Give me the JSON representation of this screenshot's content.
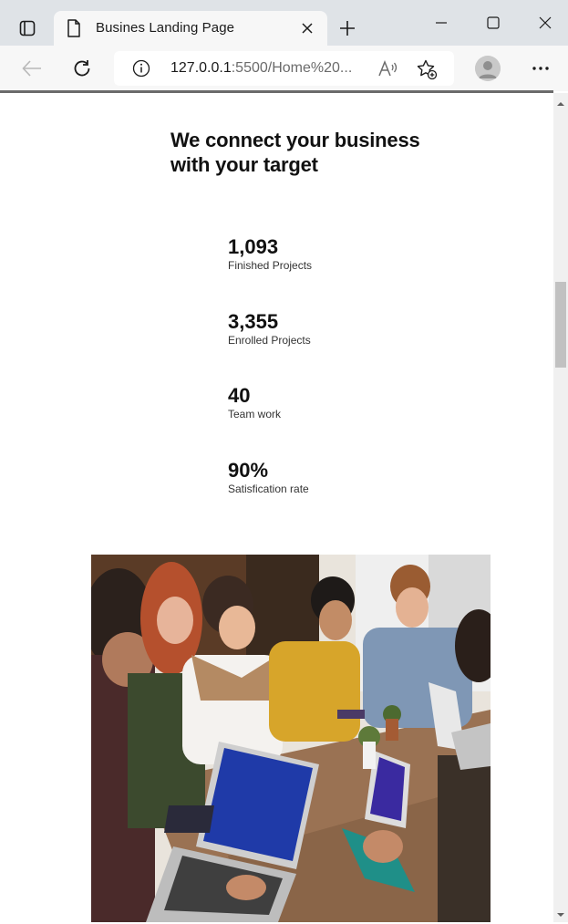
{
  "browser": {
    "tab_title": "Busines Landing Page",
    "url_host": "127.0.0.1",
    "url_path": ":5500/Home%20...",
    "read_aloud_label": "A",
    "icons": {
      "tabs": "tab-actions-icon",
      "page": "page-icon",
      "close": "close-icon",
      "new_tab": "plus-icon",
      "minimize": "minimize-icon",
      "maximize": "maximize-icon",
      "close_window": "close-window-icon",
      "back": "back-arrow-icon",
      "refresh": "refresh-icon",
      "info": "info-icon",
      "read_aloud": "read-aloud-icon",
      "favorites": "add-favorite-icon",
      "profile": "profile-avatar",
      "more": "more-icon"
    }
  },
  "page": {
    "heading": "We connect your business with your target",
    "stats": [
      {
        "value": "1,093",
        "label": "Finished Projects"
      },
      {
        "value": "3,355",
        "label": "Enrolled Projects"
      },
      {
        "value": "40",
        "label": "Team work"
      },
      {
        "value": "90%",
        "label": "Satisfication rate"
      }
    ],
    "photo_description_icon": "team-meeting-photo"
  },
  "colors": {
    "titlebar": "#dfe3e7",
    "toolbar": "#f7f7f7",
    "text": "#111111",
    "scroll_track": "#f0f0f0",
    "scroll_thumb": "#c1c1c1"
  }
}
